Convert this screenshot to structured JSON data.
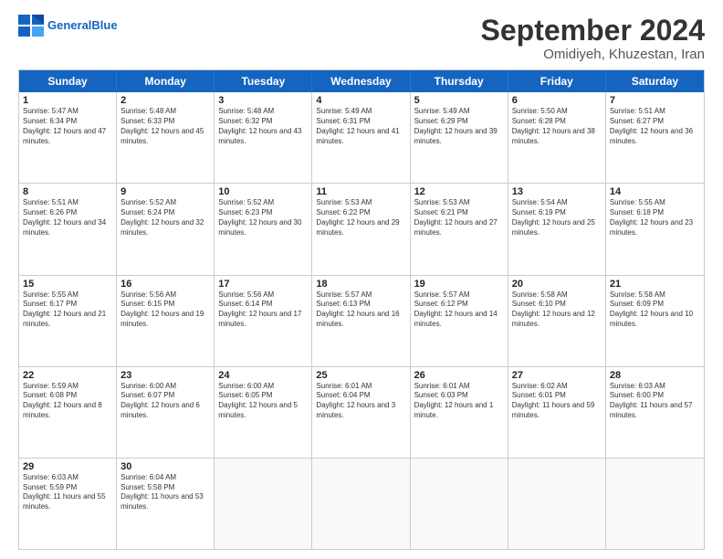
{
  "logo": {
    "general": "General",
    "blue": "Blue"
  },
  "title": "September 2024",
  "subtitle": "Omidiyeh, Khuzestan, Iran",
  "weekdays": [
    "Sunday",
    "Monday",
    "Tuesday",
    "Wednesday",
    "Thursday",
    "Friday",
    "Saturday"
  ],
  "weeks": [
    [
      {
        "day": "1",
        "sunrise": "Sunrise: 5:47 AM",
        "sunset": "Sunset: 6:34 PM",
        "daylight": "Daylight: 12 hours and 47 minutes."
      },
      {
        "day": "2",
        "sunrise": "Sunrise: 5:48 AM",
        "sunset": "Sunset: 6:33 PM",
        "daylight": "Daylight: 12 hours and 45 minutes."
      },
      {
        "day": "3",
        "sunrise": "Sunrise: 5:48 AM",
        "sunset": "Sunset: 6:32 PM",
        "daylight": "Daylight: 12 hours and 43 minutes."
      },
      {
        "day": "4",
        "sunrise": "Sunrise: 5:49 AM",
        "sunset": "Sunset: 6:31 PM",
        "daylight": "Daylight: 12 hours and 41 minutes."
      },
      {
        "day": "5",
        "sunrise": "Sunrise: 5:49 AM",
        "sunset": "Sunset: 6:29 PM",
        "daylight": "Daylight: 12 hours and 39 minutes."
      },
      {
        "day": "6",
        "sunrise": "Sunrise: 5:50 AM",
        "sunset": "Sunset: 6:28 PM",
        "daylight": "Daylight: 12 hours and 38 minutes."
      },
      {
        "day": "7",
        "sunrise": "Sunrise: 5:51 AM",
        "sunset": "Sunset: 6:27 PM",
        "daylight": "Daylight: 12 hours and 36 minutes."
      }
    ],
    [
      {
        "day": "8",
        "sunrise": "Sunrise: 5:51 AM",
        "sunset": "Sunset: 6:26 PM",
        "daylight": "Daylight: 12 hours and 34 minutes."
      },
      {
        "day": "9",
        "sunrise": "Sunrise: 5:52 AM",
        "sunset": "Sunset: 6:24 PM",
        "daylight": "Daylight: 12 hours and 32 minutes."
      },
      {
        "day": "10",
        "sunrise": "Sunrise: 5:52 AM",
        "sunset": "Sunset: 6:23 PM",
        "daylight": "Daylight: 12 hours and 30 minutes."
      },
      {
        "day": "11",
        "sunrise": "Sunrise: 5:53 AM",
        "sunset": "Sunset: 6:22 PM",
        "daylight": "Daylight: 12 hours and 29 minutes."
      },
      {
        "day": "12",
        "sunrise": "Sunrise: 5:53 AM",
        "sunset": "Sunset: 6:21 PM",
        "daylight": "Daylight: 12 hours and 27 minutes."
      },
      {
        "day": "13",
        "sunrise": "Sunrise: 5:54 AM",
        "sunset": "Sunset: 6:19 PM",
        "daylight": "Daylight: 12 hours and 25 minutes."
      },
      {
        "day": "14",
        "sunrise": "Sunrise: 5:55 AM",
        "sunset": "Sunset: 6:18 PM",
        "daylight": "Daylight: 12 hours and 23 minutes."
      }
    ],
    [
      {
        "day": "15",
        "sunrise": "Sunrise: 5:55 AM",
        "sunset": "Sunset: 6:17 PM",
        "daylight": "Daylight: 12 hours and 21 minutes."
      },
      {
        "day": "16",
        "sunrise": "Sunrise: 5:56 AM",
        "sunset": "Sunset: 6:15 PM",
        "daylight": "Daylight: 12 hours and 19 minutes."
      },
      {
        "day": "17",
        "sunrise": "Sunrise: 5:56 AM",
        "sunset": "Sunset: 6:14 PM",
        "daylight": "Daylight: 12 hours and 17 minutes."
      },
      {
        "day": "18",
        "sunrise": "Sunrise: 5:57 AM",
        "sunset": "Sunset: 6:13 PM",
        "daylight": "Daylight: 12 hours and 16 minutes."
      },
      {
        "day": "19",
        "sunrise": "Sunrise: 5:57 AM",
        "sunset": "Sunset: 6:12 PM",
        "daylight": "Daylight: 12 hours and 14 minutes."
      },
      {
        "day": "20",
        "sunrise": "Sunrise: 5:58 AM",
        "sunset": "Sunset: 6:10 PM",
        "daylight": "Daylight: 12 hours and 12 minutes."
      },
      {
        "day": "21",
        "sunrise": "Sunrise: 5:58 AM",
        "sunset": "Sunset: 6:09 PM",
        "daylight": "Daylight: 12 hours and 10 minutes."
      }
    ],
    [
      {
        "day": "22",
        "sunrise": "Sunrise: 5:59 AM",
        "sunset": "Sunset: 6:08 PM",
        "daylight": "Daylight: 12 hours and 8 minutes."
      },
      {
        "day": "23",
        "sunrise": "Sunrise: 6:00 AM",
        "sunset": "Sunset: 6:07 PM",
        "daylight": "Daylight: 12 hours and 6 minutes."
      },
      {
        "day": "24",
        "sunrise": "Sunrise: 6:00 AM",
        "sunset": "Sunset: 6:05 PM",
        "daylight": "Daylight: 12 hours and 5 minutes."
      },
      {
        "day": "25",
        "sunrise": "Sunrise: 6:01 AM",
        "sunset": "Sunset: 6:04 PM",
        "daylight": "Daylight: 12 hours and 3 minutes."
      },
      {
        "day": "26",
        "sunrise": "Sunrise: 6:01 AM",
        "sunset": "Sunset: 6:03 PM",
        "daylight": "Daylight: 12 hours and 1 minute."
      },
      {
        "day": "27",
        "sunrise": "Sunrise: 6:02 AM",
        "sunset": "Sunset: 6:01 PM",
        "daylight": "Daylight: 11 hours and 59 minutes."
      },
      {
        "day": "28",
        "sunrise": "Sunrise: 6:03 AM",
        "sunset": "Sunset: 6:00 PM",
        "daylight": "Daylight: 11 hours and 57 minutes."
      }
    ],
    [
      {
        "day": "29",
        "sunrise": "Sunrise: 6:03 AM",
        "sunset": "Sunset: 5:59 PM",
        "daylight": "Daylight: 11 hours and 55 minutes."
      },
      {
        "day": "30",
        "sunrise": "Sunrise: 6:04 AM",
        "sunset": "Sunset: 5:58 PM",
        "daylight": "Daylight: 11 hours and 53 minutes."
      },
      {
        "day": "",
        "sunrise": "",
        "sunset": "",
        "daylight": ""
      },
      {
        "day": "",
        "sunrise": "",
        "sunset": "",
        "daylight": ""
      },
      {
        "day": "",
        "sunrise": "",
        "sunset": "",
        "daylight": ""
      },
      {
        "day": "",
        "sunrise": "",
        "sunset": "",
        "daylight": ""
      },
      {
        "day": "",
        "sunrise": "",
        "sunset": "",
        "daylight": ""
      }
    ]
  ]
}
